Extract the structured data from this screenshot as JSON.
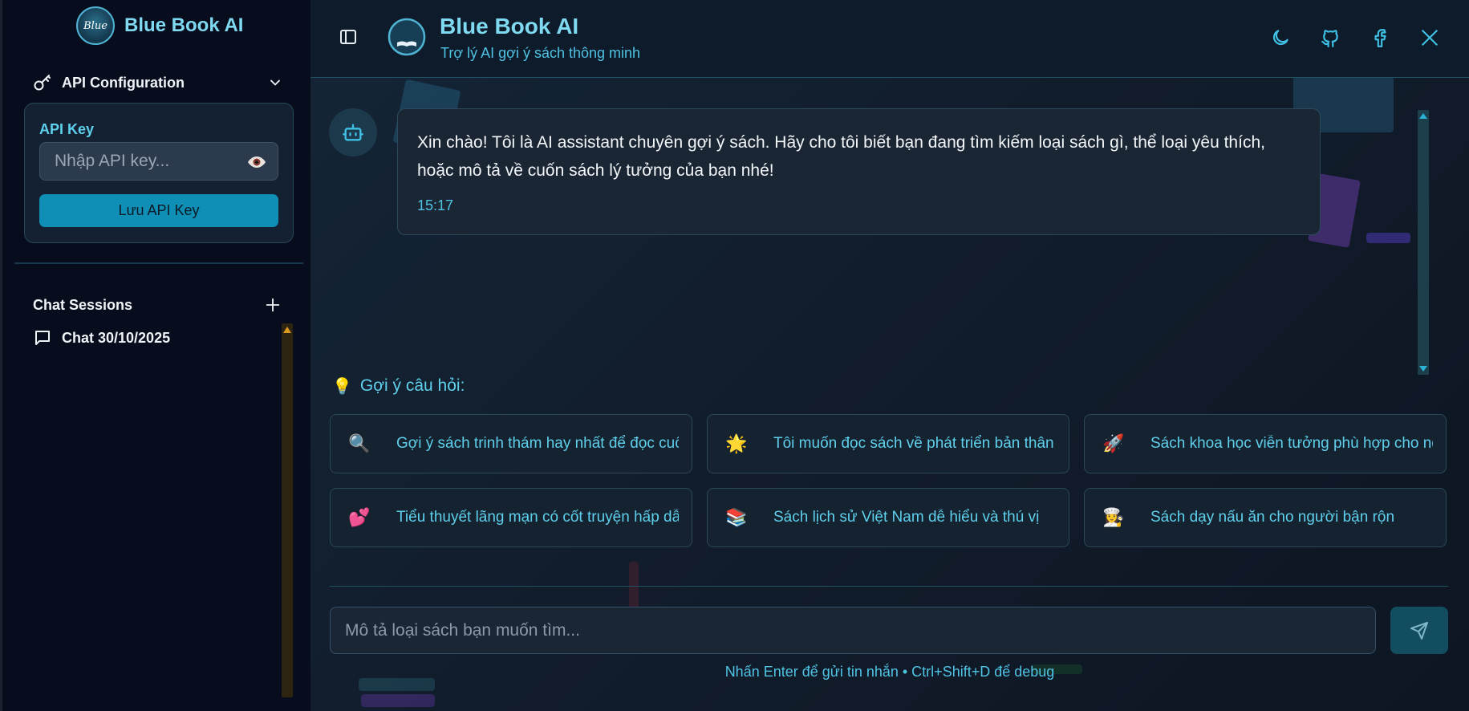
{
  "sidebar": {
    "brand_title": "Blue Book AI",
    "logo_text": "Blue",
    "api_section_title": "API Configuration",
    "api_key_label": "API Key",
    "api_key_placeholder": "Nhập API key...",
    "save_button": "Lưu API Key",
    "chat_sessions_title": "Chat Sessions",
    "sessions": [
      {
        "label": "Chat 30/10/2025"
      }
    ]
  },
  "header": {
    "title": "Blue Book AI",
    "subtitle": "Trợ lý AI gợi ý sách thông minh",
    "icons": [
      "moon-icon",
      "github-icon",
      "facebook-icon",
      "x-icon"
    ]
  },
  "messages": [
    {
      "sender": "bot",
      "text": "Xin chào! Tôi là AI assistant chuyên gợi ý sách. Hãy cho tôi biết bạn đang tìm kiếm loại sách gì, thể loại yêu thích, hoặc mô tả về cuốn sách lý tưởng của bạn nhé!",
      "time": "15:17"
    }
  ],
  "suggestions": {
    "title": "Gợi ý câu hỏi:",
    "items": [
      {
        "emoji": "🔍",
        "text": "Gợi ý sách trinh thám hay nhất để đọc cuối tuần"
      },
      {
        "emoji": "🌟",
        "text": "Tôi muốn đọc sách về phát triển bản thân"
      },
      {
        "emoji": "🚀",
        "text": "Sách khoa học viễn tưởng phù hợp cho người mới"
      },
      {
        "emoji": "💕",
        "text": "Tiểu thuyết lãng mạn có cốt truyện hấp dẫn"
      },
      {
        "emoji": "📚",
        "text": "Sách lịch sử Việt Nam dễ hiểu và thú vị"
      },
      {
        "emoji": "👩‍🍳",
        "text": "Sách dạy nấu ăn cho người bận rộn"
      }
    ]
  },
  "input": {
    "placeholder": "Mô tả loại sách bạn muốn tìm...",
    "hint": "Nhấn Enter để gửi tin nhắn • Ctrl+Shift+D để debug"
  },
  "colors": {
    "accent": "#4fc3e3",
    "brand": "#7fd9f0",
    "button": "#0f8fb6",
    "background": "#0b1220"
  }
}
